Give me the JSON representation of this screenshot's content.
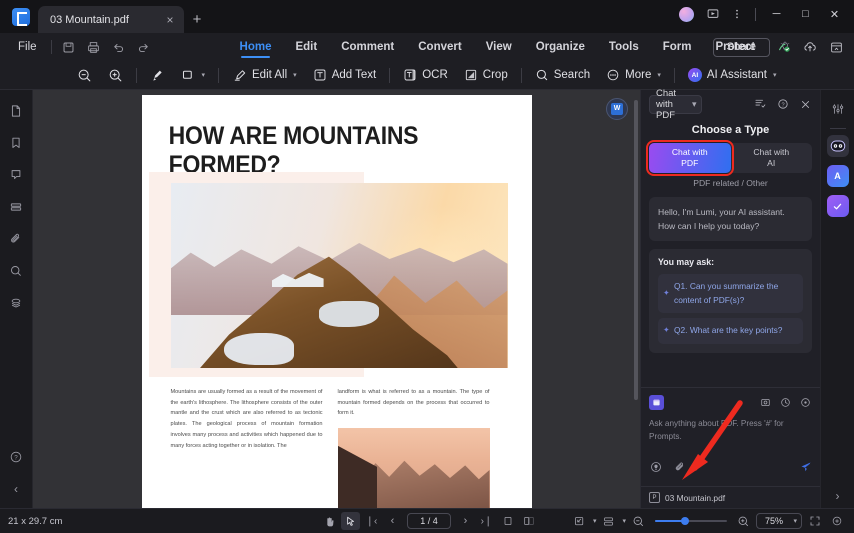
{
  "window": {
    "tab_title": "03 Mountain.pdf",
    "tab_close": "×",
    "new_tab": "+",
    "minimize": "─",
    "maximize": "□",
    "close": "✕"
  },
  "menubar": {
    "file": "File",
    "tabs": [
      {
        "label": "Home",
        "active": true
      },
      {
        "label": "Edit",
        "active": false
      },
      {
        "label": "Comment",
        "active": false
      },
      {
        "label": "Convert",
        "active": false
      },
      {
        "label": "View",
        "active": false
      },
      {
        "label": "Organize",
        "active": false
      },
      {
        "label": "Tools",
        "active": false
      },
      {
        "label": "Form",
        "active": false
      },
      {
        "label": "Protect",
        "active": false
      }
    ],
    "share_label": "Share"
  },
  "toolbar": {
    "zoom_out": "zoom-out-icon",
    "zoom_in": "zoom-in-icon",
    "highlight": "highlight-icon",
    "shape": "shape-icon",
    "edit_all": "Edit All",
    "add_text": "Add Text",
    "ocr": "OCR",
    "crop": "Crop",
    "search": "Search",
    "more": "More",
    "ai_assistant": "AI Assistant",
    "ai_badge": "AI"
  },
  "left_rail": {
    "items": [
      {
        "name": "page-thumbnails-icon"
      },
      {
        "name": "bookmark-icon"
      },
      {
        "name": "comment-icon"
      },
      {
        "name": "layers-list-icon"
      },
      {
        "name": "attachment-icon"
      },
      {
        "name": "search-icon"
      },
      {
        "name": "stamp-icon"
      }
    ],
    "help": "?",
    "collapse": "‹"
  },
  "document": {
    "title": "HOW ARE MOUNTAINS FORMED?",
    "column_left": "Mountains are usually formed as a result of the movement of the earth's lithosphere. The lithosphere consists of the outer mantle and the crust which are also referred to as tectonic plates. The geological process of mountain formation involves many process and activities which happened due to many forces acting together or in isolation. The",
    "column_right": "landform is what is referred to as a mountain. The type of mountain formed depends on the process that occurred to form it.",
    "convert_badge": "W"
  },
  "chat": {
    "mode_select": "Chat with PDF",
    "mode_caret": "⌄",
    "header_icons": [
      "new-chat-icon",
      "help-icon",
      "close-icon"
    ],
    "choose_title": "Choose a Type",
    "option_pdf_line1": "Chat with",
    "option_pdf_line2": "PDF",
    "option_ai_line1": "Chat with",
    "option_ai_line2": "AI",
    "note": "PDF related / Other",
    "greeting": "Hello, I'm Lumi, your AI assistant. How can I help you today?",
    "suggestions_title": "You may ask:",
    "suggestions": [
      "Q1. Can you summarize the content of PDF(s)?",
      "Q2. What are the key points?"
    ],
    "input_placeholder": "Ask anything about PDF. Press '#' for Prompts.",
    "attached_file": "03 Mountain.pdf",
    "highlight_color": "#ee2a1f",
    "gradient_from": "#9a4bf0",
    "gradient_to": "#2f6ff0"
  },
  "right_rail": {
    "items": [
      {
        "name": "settings-sliders-icon",
        "active": false
      },
      {
        "name": "ai-robot-icon",
        "active": true
      },
      {
        "name": "translate-icon",
        "active": false
      },
      {
        "name": "checkmark-icon",
        "active": false
      }
    ],
    "expand": "›"
  },
  "statusbar": {
    "page_dimensions": "21 x 29.7 cm",
    "hand_tool": "hand-tool-icon",
    "select_tool": "select-tool-icon",
    "first_page": "❘‹",
    "prev_page": "‹",
    "page_indicator": "1 / 4",
    "next_page": "›",
    "last_page": "›❘",
    "single_page_view": "single-page-icon",
    "facing_page_view": "facing-page-icon",
    "zoom_out": "⊖",
    "zoom_in": "⊕",
    "zoom_level": "75%",
    "fit_screen": "fit-screen-icon",
    "rotate": "rotate-icon"
  }
}
